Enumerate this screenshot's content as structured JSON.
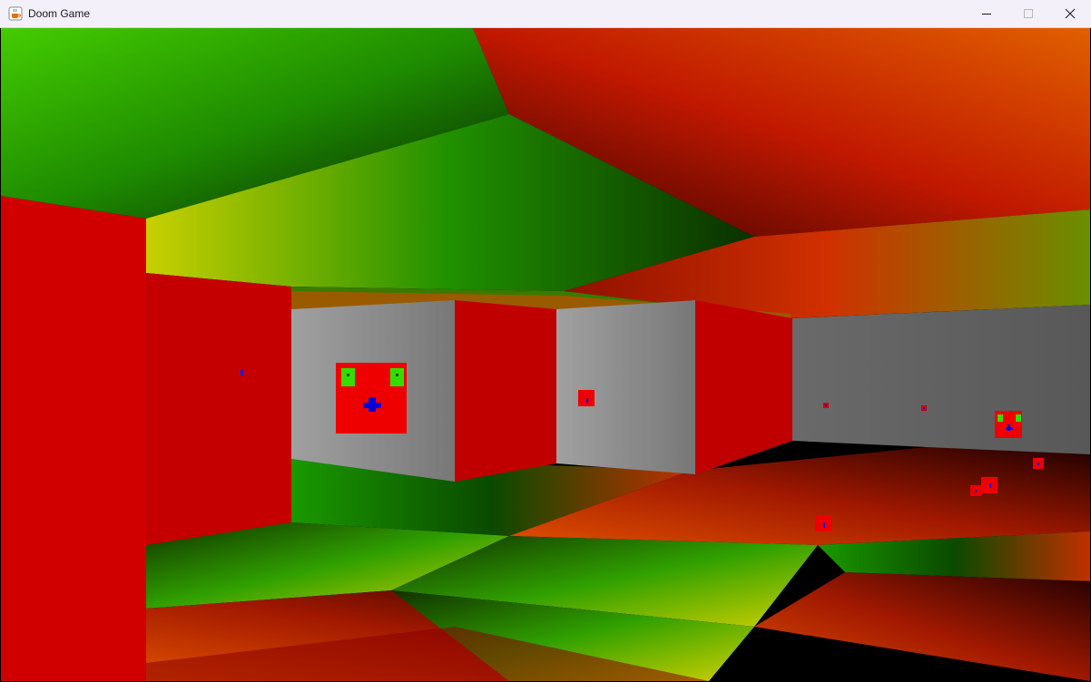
{
  "window": {
    "title": "Doom Game",
    "icon": "java-cup-icon",
    "controls": {
      "minimize": "minimize-icon",
      "maximize": "maximize-icon",
      "close": "close-icon"
    }
  },
  "scene": {
    "type": "raycast-3d-view",
    "colors": {
      "wall_red": "#d00000",
      "wall_red_dark": "#b80000",
      "wall_gray_light": "#8c8c8c",
      "wall_gray_dark": "#5a5a5a",
      "floor_green": "#1a9900",
      "floor_yellow": "#c8c800",
      "floor_red": "#c82000",
      "ceiling_green": "#22c000",
      "ceiling_red": "#d03000",
      "enemy_body": "#ee0000",
      "enemy_eyes": "#33dd00",
      "enemy_mouth": "#0000dd"
    },
    "enemies_visible": 9
  }
}
